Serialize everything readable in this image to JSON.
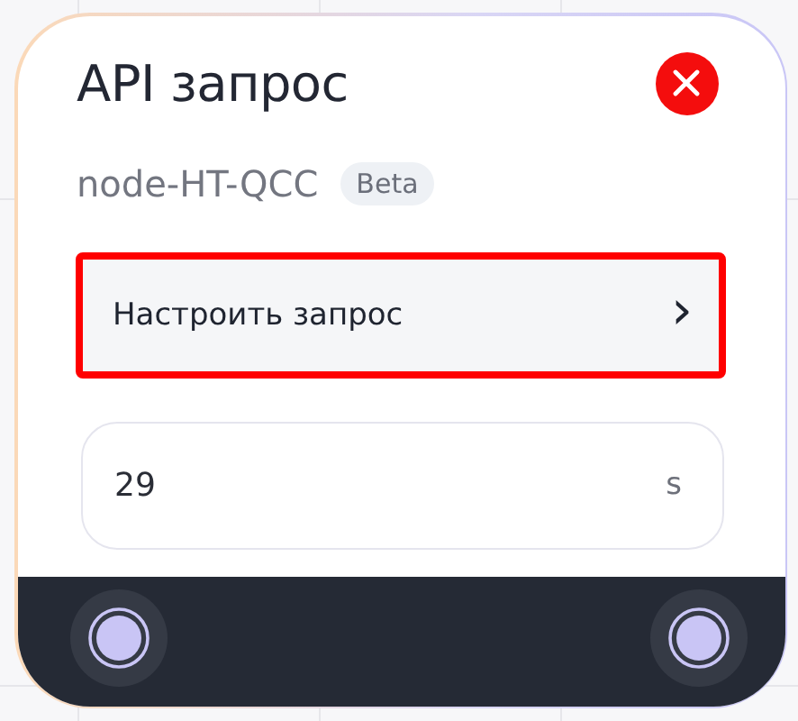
{
  "node": {
    "title": "API запрос",
    "node_id": "node-HT-QCC",
    "badge": "Beta",
    "configure_button": {
      "label": "Настроить запрос",
      "chevron": "›",
      "highlighted": true
    },
    "timeout_field": {
      "value": "29",
      "unit": "s"
    },
    "handles": [
      {
        "kind": "port"
      },
      {
        "kind": "port"
      }
    ]
  }
}
